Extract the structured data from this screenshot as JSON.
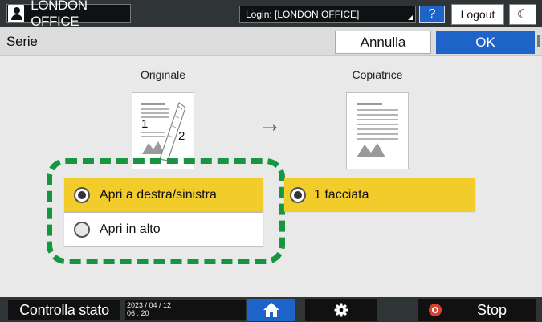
{
  "topbar": {
    "user_name": "LONDON OFFICE",
    "login_text": "Login: [LONDON OFFICE]",
    "help_label": "?",
    "logout_label": "Logout",
    "moon_glyph": "☾"
  },
  "header": {
    "title": "Serie",
    "cancel_label": "Annulla",
    "ok_label": "OK"
  },
  "main": {
    "original_label": "Originale",
    "copy_label": "Copiatrice",
    "original_page_numbers": [
      "1",
      "2"
    ],
    "arrow_glyph": "→",
    "left_options": [
      {
        "label": "Apri a destra/sinistra",
        "selected": true
      },
      {
        "label": "Apri in alto",
        "selected": false
      }
    ],
    "right_option": {
      "label": "1 facciata",
      "selected": true
    }
  },
  "bottombar": {
    "status_label": "Controlla stato",
    "date": "2023 / 04 / 12",
    "time": "06 : 20",
    "stop_label": "Stop"
  },
  "colors": {
    "accent_blue": "#1e64c8",
    "selected_yellow": "#f2cc2a",
    "highlight_green": "#16963e",
    "stop_red": "#d8432f"
  },
  "icons": {
    "user": "user-icon",
    "home": "home-icon",
    "settings": "gear-icon",
    "stop": "stop-icon",
    "moon": "moon-icon",
    "arrow": "arrow-right-icon"
  }
}
